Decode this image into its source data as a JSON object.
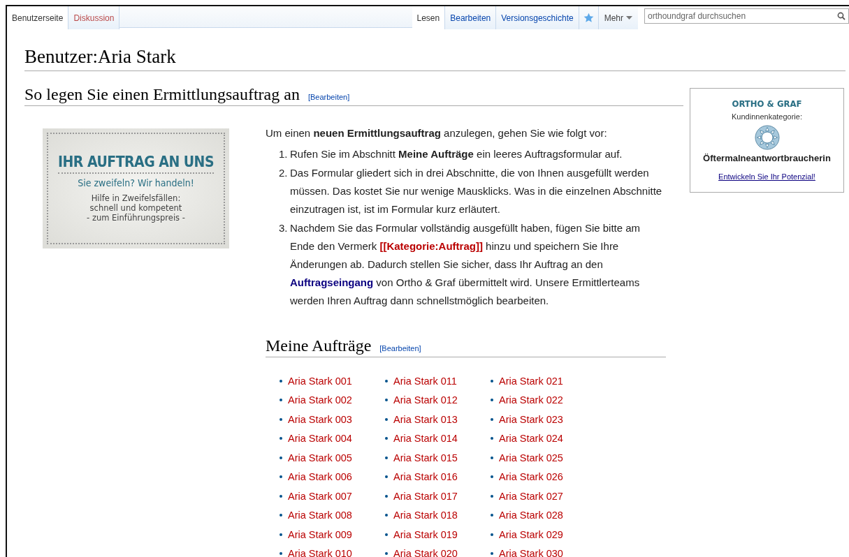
{
  "namespace_tabs": [
    {
      "label": "Benutzerseite",
      "selected": true,
      "missing": false
    },
    {
      "label": "Diskussion",
      "selected": false,
      "missing": true
    }
  ],
  "view_tabs": [
    {
      "label": "Lesen",
      "selected": true
    },
    {
      "label": "Bearbeiten",
      "selected": false
    },
    {
      "label": "Versionsgeschichte",
      "selected": false
    }
  ],
  "more_menu": {
    "label": "Mehr"
  },
  "search": {
    "placeholder": "orthoundgraf durchsuchen"
  },
  "page_title": "Benutzer:Aria Stark",
  "section_1": {
    "title": "So legen Sie einen Ermittlungsauftrag an",
    "edit_link": "[Bearbeiten]"
  },
  "banner": {
    "kind": "picture",
    "title": "IHR AUFTRAG AN UNS",
    "subtitle": "Sie zweifeln? Wir handeln!",
    "lines": [
      "Hilfe in Zweifelsfällen:",
      "schnell und kompetent",
      "- zum Einführungspreis -"
    ]
  },
  "intro": "Um einen **neuen Ermittlungsauftrag** anzulegen, gehen Sie wie folgt vor:",
  "steps": [
    {
      "number": "1.",
      "parts": [
        {
          "kind": "text",
          "text": "Rufen Sie im Abschnitt **Meine Aufträge** ein leeres Auftragsformular auf."
        }
      ]
    },
    {
      "number": "2.",
      "parts": [
        {
          "kind": "text",
          "text": "Das Formular gliedert sich in drei Abschnitte, die von Ihnen ausgefüllt werden müssen. Das kostet Sie nur wenige Mausklicks. Was in die einzelnen Abschnitte einzutragen ist, ist im Formular kurz erläutert."
        }
      ]
    },
    {
      "number": "3.",
      "parts": [
        {
          "kind": "text",
          "text": "Nachdem Sie das Formular vollständig ausgefüllt haben, fügen Sie bitte am Ende den Vermerk"
        },
        {
          "kind": "category-link",
          "text": "[[Kategorie:Auftrag]]"
        },
        {
          "kind": "text",
          "text": "hinzu und speichern Sie Ihre Änderungen ab. Dadurch stellen Sie sicher, dass Ihr Auftrag an den"
        },
        {
          "kind": "page-link",
          "text": "Auftragseingang"
        },
        {
          "kind": "text",
          "text": "von Ortho & Graf übermittelt wird. Unsere Ermittlerteams werden Ihren Auftrag dann schnellstmöglich bearbeiten."
        }
      ]
    }
  ],
  "infobox": {
    "brand": "ORTHO & GRAF",
    "label": "Kundinnenkategorie:",
    "category": "Öftermalneantwortbraucherin",
    "link": "Entwickeln Sie Ihr Potenzial!"
  },
  "section_2": {
    "title": "Meine Aufträge",
    "edit_link": "[Bearbeiten]"
  },
  "orders": [
    [
      "Aria Stark 001",
      "Aria Stark 002",
      "Aria Stark 003",
      "Aria Stark 004",
      "Aria Stark 005",
      "Aria Stark 006",
      "Aria Stark 007",
      "Aria Stark 008",
      "Aria Stark 009",
      "Aria Stark 010"
    ],
    [
      "Aria Stark 011",
      "Aria Stark 012",
      "Aria Stark 013",
      "Aria Stark 014",
      "Aria Stark 015",
      "Aria Stark 016",
      "Aria Stark 017",
      "Aria Stark 018",
      "Aria Stark 019",
      "Aria Stark 020"
    ],
    [
      "Aria Stark 021",
      "Aria Stark 022",
      "Aria Stark 023",
      "Aria Stark 024",
      "Aria Stark 025",
      "Aria Stark 026",
      "Aria Stark 027",
      "Aria Stark 028",
      "Aria Stark 029",
      "Aria Stark 030"
    ]
  ]
}
